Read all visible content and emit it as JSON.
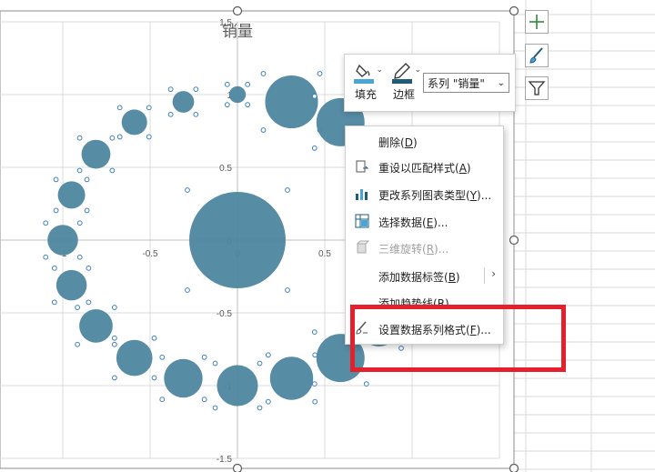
{
  "chart": {
    "title": "销量",
    "x_tick_labels": [
      "-1",
      "-0.5",
      "0",
      "0.5"
    ],
    "y_tick_labels": [
      "1.5",
      "1",
      "0.5",
      "0",
      "-0.5",
      "-1",
      "-1.5"
    ],
    "bubble_color": "#4e86a0"
  },
  "chart_data": {
    "type": "scatter",
    "subtype": "bubble",
    "title": "销量",
    "xlim": [
      -1.5,
      1.5
    ],
    "ylim": [
      -1.5,
      1.5
    ],
    "grid": true,
    "series": [
      {
        "name": "销量",
        "x": [
          0,
          0,
          0.31,
          0.59,
          0.81,
          0.95,
          1.0,
          0.95,
          0.81,
          0.59,
          0.31,
          0,
          -0.31,
          -0.59,
          -0.81,
          -0.95,
          -1.0,
          -0.95,
          -0.81,
          -0.59,
          -0.31
        ],
        "y": [
          0,
          1.0,
          0.95,
          0.81,
          0.59,
          0.31,
          0,
          -0.31,
          -0.59,
          -0.81,
          -0.95,
          -1.0,
          -0.95,
          -0.81,
          -0.59,
          -0.31,
          0,
          0.31,
          0.59,
          0.81,
          0.95
        ],
        "size": [
          100,
          3,
          30,
          25,
          18,
          14,
          12,
          14,
          18,
          25,
          20,
          18,
          16,
          14,
          12,
          10,
          10,
          8,
          9,
          7,
          5
        ]
      }
    ]
  },
  "mini_toolbar": {
    "fill_label": "填充",
    "border_label": "边框",
    "series_select": "系列 \"销量\""
  },
  "context_menu": {
    "items": [
      {
        "label": "删除(",
        "key": "D",
        "end": ")"
      },
      {
        "label": "重设以匹配样式(",
        "key": "A",
        "end": ")"
      },
      {
        "label": "更改系列图表类型(",
        "key": "Y",
        "end": ")..."
      },
      {
        "label": "选择数据(",
        "key": "E",
        "end": ")..."
      },
      {
        "label": "三维旋转(",
        "key": "R",
        "end": ")..."
      },
      {
        "label": "添加数据标签(",
        "key": "B",
        "end": ")"
      },
      {
        "label": "添加趋势线(",
        "key": "R",
        "end": ")..."
      },
      {
        "label": "设置数据系列格式(",
        "key": "F",
        "end": ")..."
      }
    ]
  },
  "side_buttons": [
    "chart-elements",
    "chart-styles",
    "chart-filters"
  ],
  "colors": {
    "accent_red": "#e3202b",
    "fill_blue": "#4aa3d9",
    "border_teal": "#1f5c78"
  }
}
